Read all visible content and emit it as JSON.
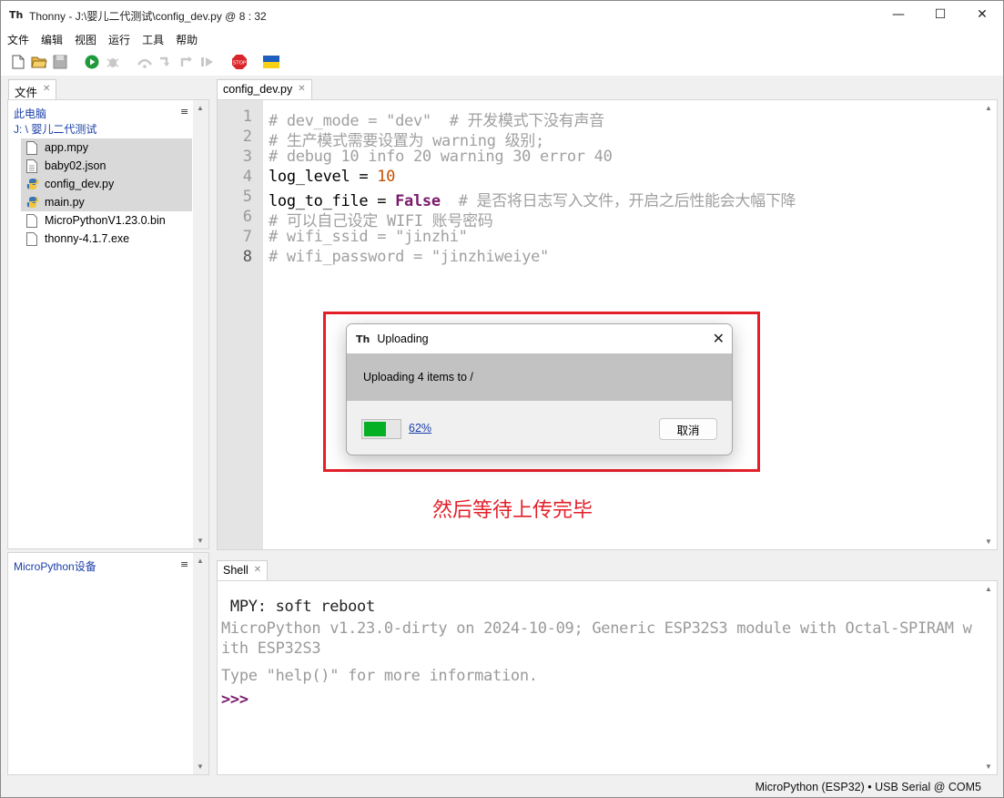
{
  "window": {
    "title": "Thonny  -  J:\\婴儿二代测试\\config_dev.py  @  8 : 32",
    "minimize": "—",
    "maximize": "☐",
    "close": "✕"
  },
  "menu": [
    "文件",
    "编辑",
    "视图",
    "运行",
    "工具",
    "帮助"
  ],
  "toolbar": {
    "icons": [
      "new-file-icon",
      "open-file-icon",
      "save-icon",
      "run-icon",
      "debug-icon",
      "step-over-icon",
      "step-into-icon",
      "step-out-icon",
      "resume-icon",
      "stop-icon",
      "ukraine-flag-icon"
    ],
    "stop_label": "STOP"
  },
  "files_panel": {
    "tab_label": "文件",
    "section_title": "此电脑",
    "path": "J: \\ 婴儿二代测试",
    "files": [
      {
        "name": "app.mpy",
        "icon": "file-icon",
        "selected": true
      },
      {
        "name": "baby02.json",
        "icon": "file-icon",
        "selected": true
      },
      {
        "name": "config_dev.py",
        "icon": "python-file-icon",
        "selected": true
      },
      {
        "name": "main.py",
        "icon": "python-file-icon",
        "selected": true
      },
      {
        "name": "MicroPythonV1.23.0.bin",
        "icon": "file-icon",
        "selected": false
      },
      {
        "name": "thonny-4.1.7.exe",
        "icon": "file-icon",
        "selected": false
      }
    ],
    "menu_glyph": "≡"
  },
  "device_panel": {
    "title": "MicroPython设备",
    "menu_glyph": "≡"
  },
  "editor": {
    "tab_label": "config_dev.py",
    "lines": [
      {
        "no": "1",
        "parts": [
          {
            "t": "# dev_mode = \"dev\"  # 开发模式下没有声音",
            "c": "c-comment"
          }
        ]
      },
      {
        "no": "2",
        "parts": [
          {
            "t": "# 生产模式需要设置为 warning 级别;",
            "c": "c-comment"
          }
        ]
      },
      {
        "no": "3",
        "parts": [
          {
            "t": "# debug 10 info 20 warning 30 error 40",
            "c": "c-comment"
          }
        ]
      },
      {
        "no": "4",
        "parts": [
          {
            "t": "log_level = ",
            "c": ""
          },
          {
            "t": "10",
            "c": "c-num"
          }
        ]
      },
      {
        "no": "5",
        "parts": [
          {
            "t": "log_to_file = ",
            "c": ""
          },
          {
            "t": "False",
            "c": "c-kw"
          },
          {
            "t": "  # 是否将日志写入文件，开启之后性能会大幅下降",
            "c": "c-comment"
          }
        ]
      },
      {
        "no": "6",
        "parts": [
          {
            "t": "# 可以自己设定 WIFI 账号密码",
            "c": "c-comment"
          }
        ]
      },
      {
        "no": "7",
        "parts": [
          {
            "t": "# wifi_ssid = \"jinzhi\"",
            "c": "c-comment"
          }
        ]
      },
      {
        "no": "8",
        "parts": [
          {
            "t": "# wifi_password = \"jinzhiweiye\"",
            "c": "c-comment"
          }
        ]
      }
    ]
  },
  "dialog": {
    "title": "Uploading",
    "close": "✕",
    "message": "Uploading 4 items to /",
    "progress_percent": 62,
    "progress_label": "62%",
    "cancel_label": "取消"
  },
  "annotation": {
    "text": "然后等待上传完毕",
    "color": "#e3202a"
  },
  "shell": {
    "tab_label": "Shell",
    "lines": [
      {
        "text": " MPY: soft reboot",
        "style": "dark"
      },
      {
        "text": "MicroPython v1.23.0-dirty on 2024-10-09; Generic ESP32S3 module with Octal-SPIRAM w",
        "style": "gray"
      },
      {
        "text": "ith ESP32S3",
        "style": "gray"
      },
      {
        "text": "Type \"help()\" for more information.",
        "style": "gray"
      }
    ],
    "prompt": ">>>"
  },
  "statusbar": {
    "text": "MicroPython (ESP32)  •  USB Serial @ COM5"
  },
  "colors": {
    "accent_red": "#e3202a",
    "progress_green": "#06b025",
    "link_blue": "#1a3ea8",
    "keyword_purple": "#7a1b6b"
  }
}
